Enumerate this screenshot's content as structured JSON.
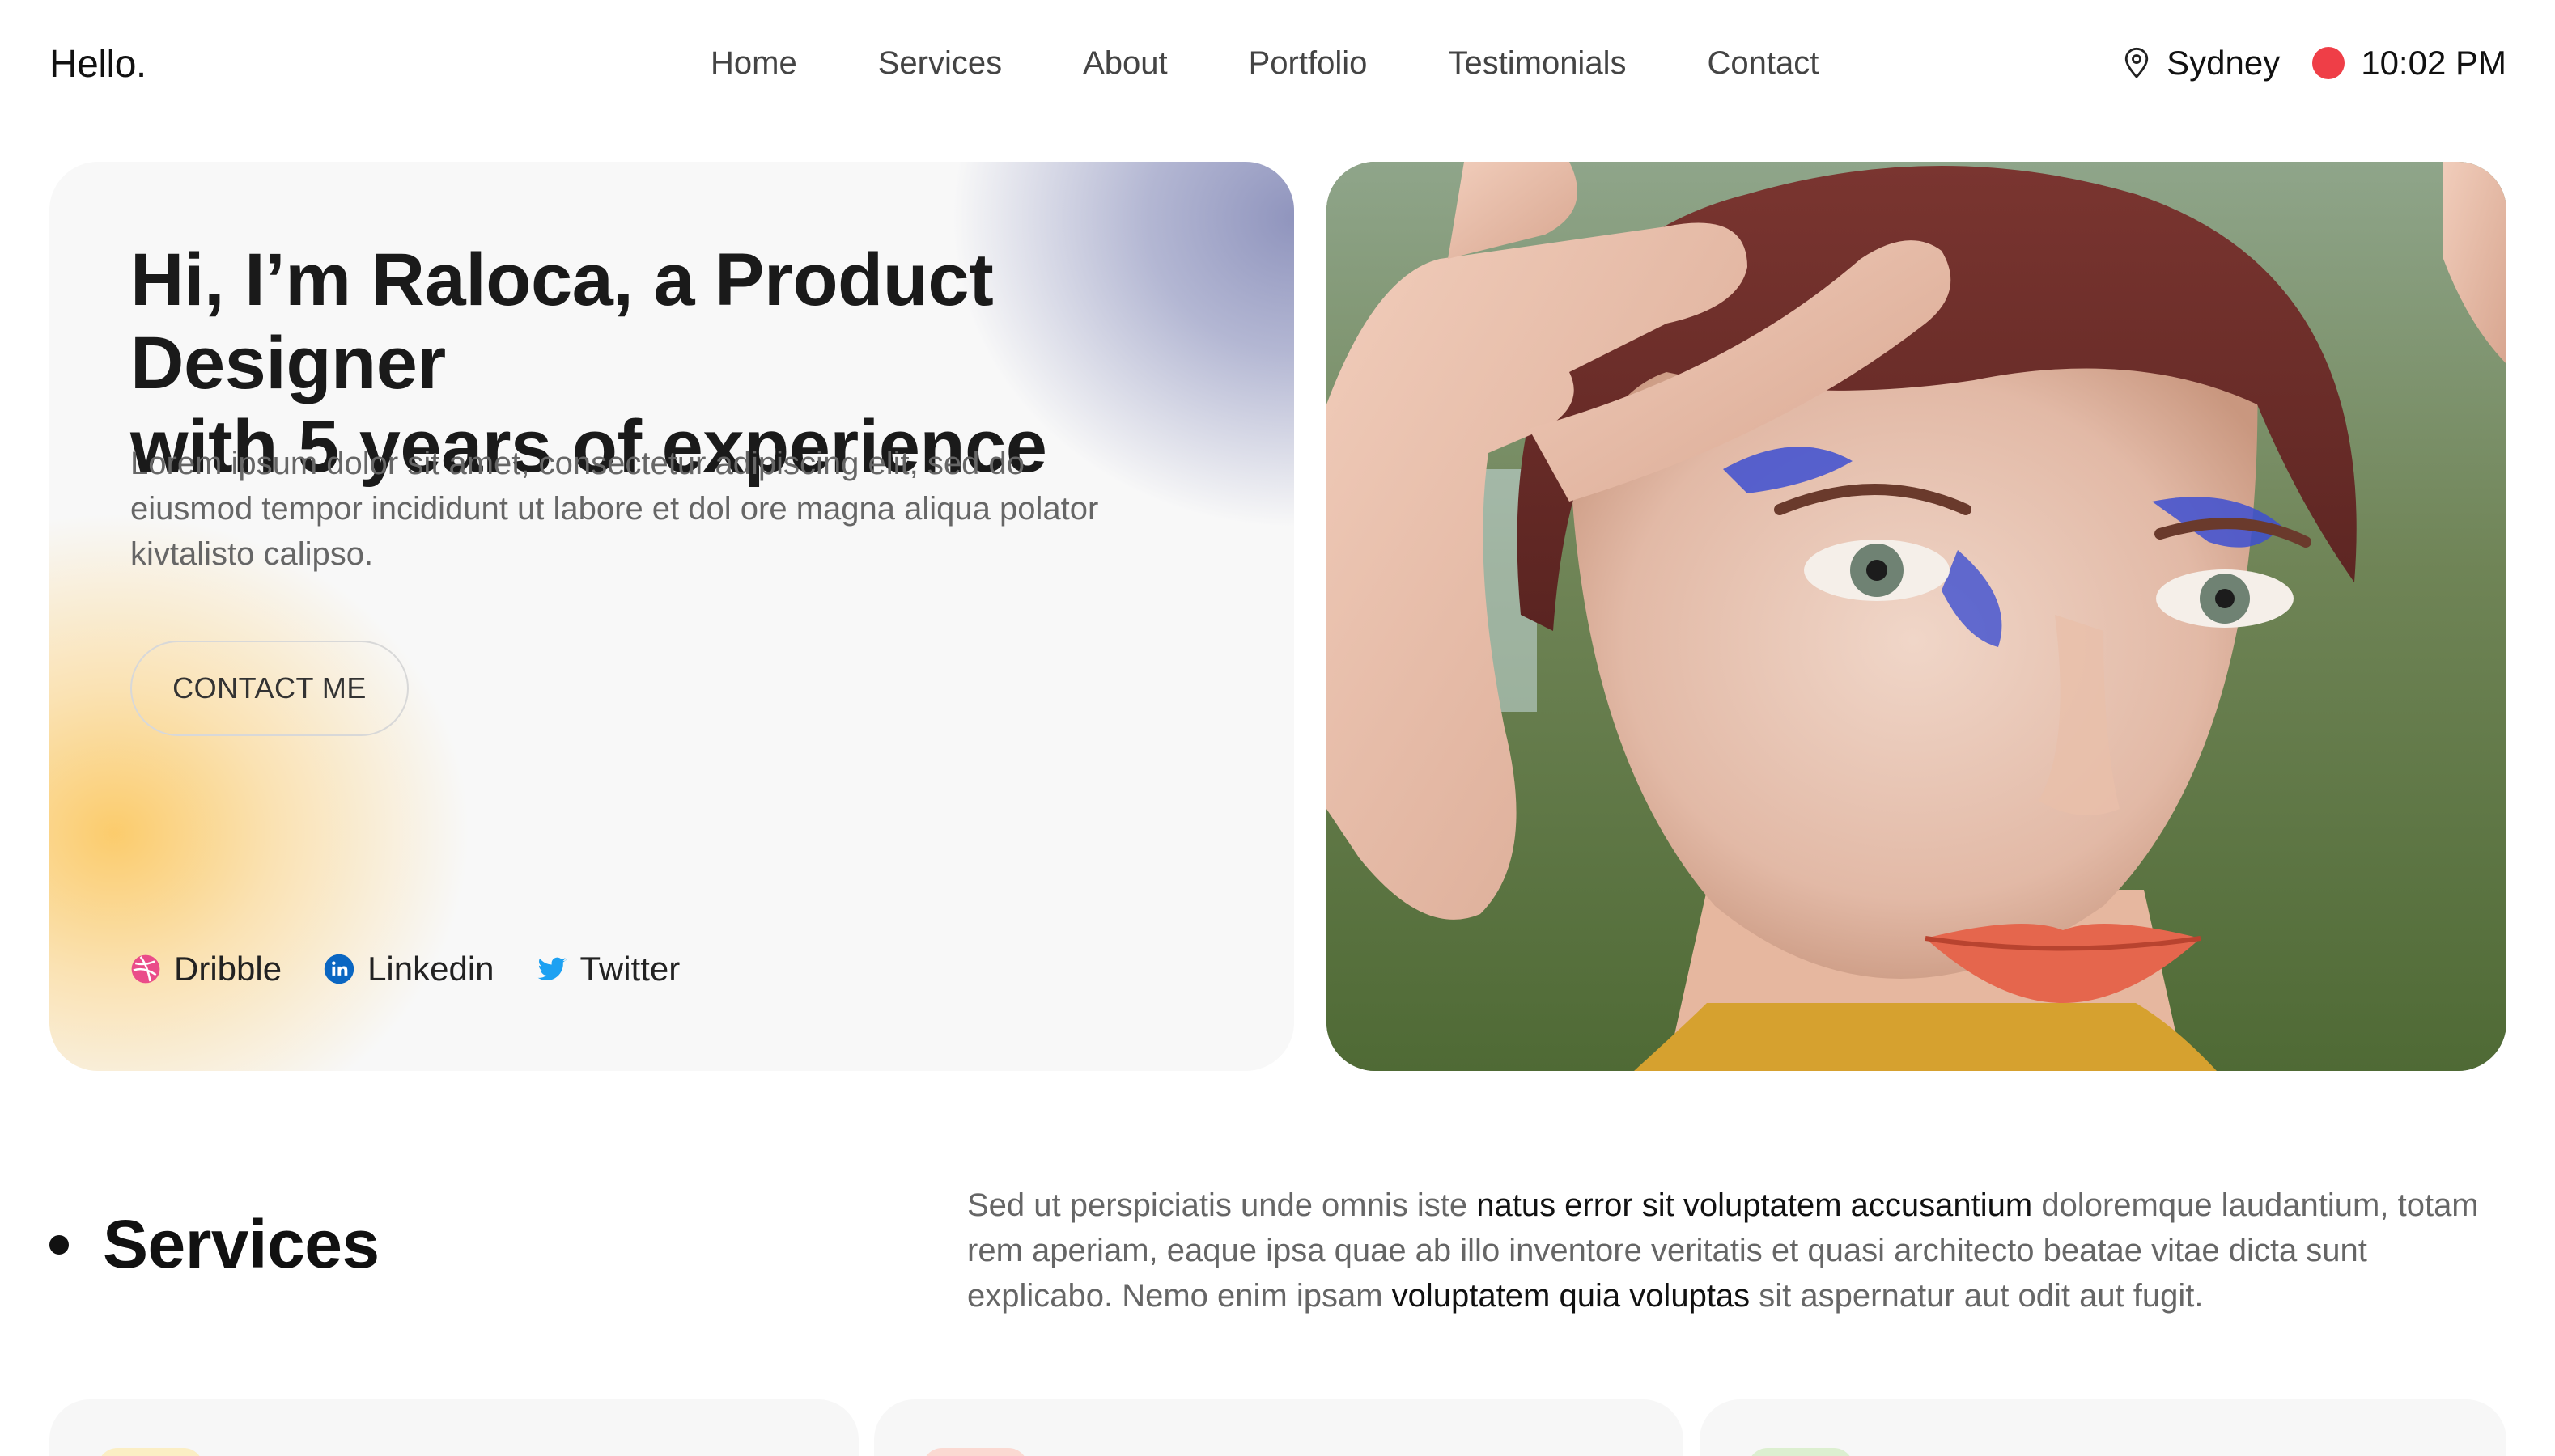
{
  "header": {
    "logo": "Hello.",
    "nav": [
      "Home",
      "Services",
      "About",
      "Portfolio",
      "Testimonials",
      "Contact"
    ],
    "location": "Sydney",
    "time": "10:02 PM",
    "status_dot_color": "#ef3e47"
  },
  "hero": {
    "title_line1": "Hi, I’m Raloca, a Product Designer",
    "title_line2": "with 5 years of experience",
    "description": "Lorem ipsum dolor sit amet, consectetur adipiscing elit, sed do eiusmod tempor incididunt ut labore et dol ore magna aliqua polator kivtalisto calipso.",
    "cta_label": "CONTACT ME",
    "socials": [
      {
        "label": "Dribble",
        "icon": "dribbble-icon",
        "color": "#ea4c89"
      },
      {
        "label": "Linkedin",
        "icon": "linkedin-icon",
        "color": "#0a66c2"
      },
      {
        "label": "Twitter",
        "icon": "twitter-icon",
        "color": "#1da1f2"
      }
    ],
    "photo": "portrait-photo"
  },
  "services": {
    "heading": "Services",
    "text_part1": "Sed ut perspiciatis unde omnis iste ",
    "text_bold1": "natus error sit voluptatem accusantium",
    "text_part2": " doloremque laudantium, totam rem aperiam, eaque ipsa quae ab illo inventore veritatis et quasi architecto beatae vitae dicta sunt explicabo. Nemo enim ipsam ",
    "text_bold2": "voluptatem quia voluptas",
    "text_part3": " sit aspernatur aut odit aut fugit.",
    "card_tag_colors": [
      "#fbeec4",
      "#fbd9d2",
      "#dcefd0"
    ]
  }
}
